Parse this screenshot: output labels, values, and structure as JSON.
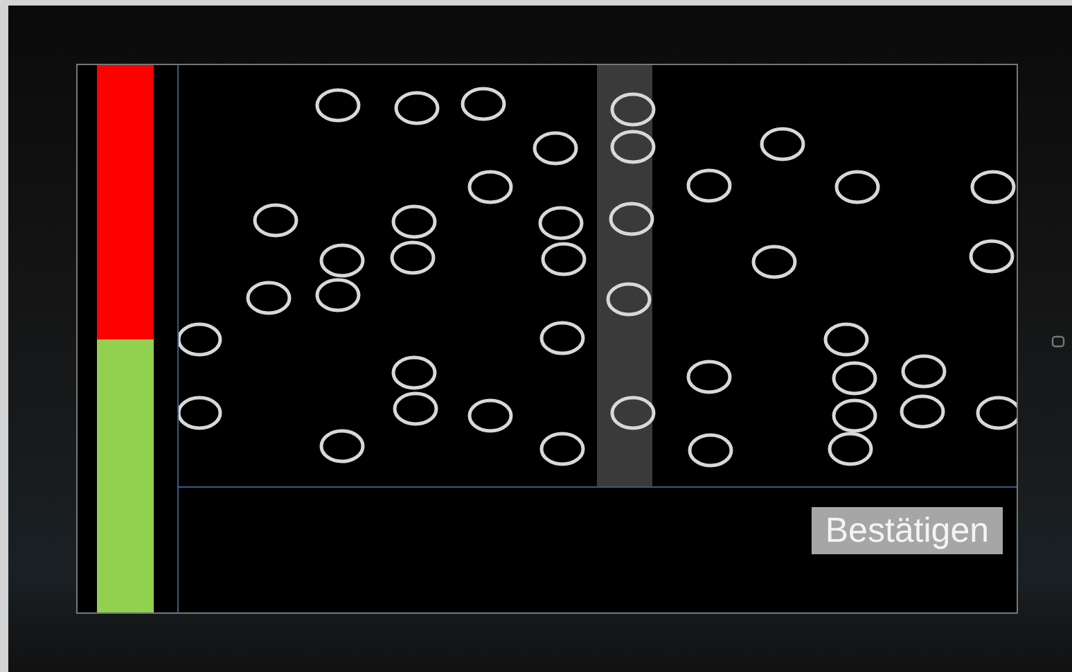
{
  "meter": {
    "level": 0.5
  },
  "confirm_button": {
    "label": "Bestätigen"
  }
}
